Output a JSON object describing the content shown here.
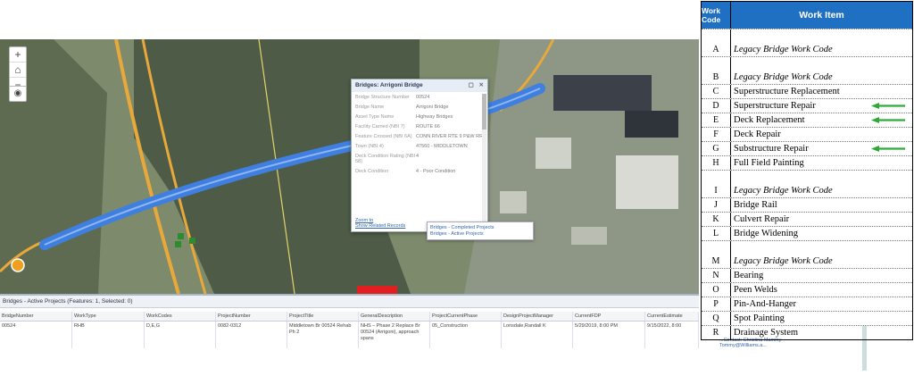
{
  "map": {
    "icons": {
      "zoom_in": "plus-icon",
      "home": "home-icon",
      "zoom_out": "minus-icon",
      "locate": "locate-icon"
    },
    "glyphs": {
      "zoom_in": "+",
      "home": "⌂",
      "zoom_out": "−",
      "locate": "◉"
    },
    "colors": {
      "bridge_highlight": "#3f7fe0",
      "river": "#4e5b47",
      "road": "#e8a93a",
      "active_project": "#e02020"
    }
  },
  "popup": {
    "title": "Bridges: Arrigoni Bridge",
    "controls": [
      "▢",
      "✕"
    ],
    "fields": [
      {
        "label": "Bridge Structure Number",
        "value": "00524"
      },
      {
        "label": "Bridge Name",
        "value": "Arrigoni Bridge"
      },
      {
        "label": "Asset Type Name",
        "value": "Highway Bridges"
      },
      {
        "label": "Facility Carried (NBI 7)",
        "value": "ROUTE 66"
      },
      {
        "label": "Feature Crossed (NBI 6A)",
        "value": "CONN RIVER RTE 9 P&W RR"
      },
      {
        "label": "Town (NBI 4)",
        "value": "47560 - MIDDLETOWN"
      },
      {
        "label": "Deck Condition Rating (NBI 58)",
        "value": "4"
      },
      {
        "label": "Deck Condition",
        "value": "4 - Poor Condition"
      }
    ],
    "links": {
      "zoom": "Zoom to",
      "related": "Show Related Records"
    }
  },
  "related_menu": {
    "items": [
      "Bridges - Completed Projects",
      "Bridges - Active Projects"
    ]
  },
  "table": {
    "title": "Bridges - Active Projects (Features: 1, Selected: 0)",
    "columns": [
      "BridgeNumber",
      "WorkType",
      "WorkCodes",
      "ProjectNumber",
      "ProjectTitle",
      "GeneralDescription",
      "ProjectCurrentPhase",
      "DesignProjectManager",
      "CurrentFDP",
      "CurrentEstimate"
    ],
    "rows": [
      [
        "00524",
        "RHB",
        "D,E,G",
        "0082-0312",
        "Middletown Br 00524 Rehab Ph 2",
        "NHS – Phase 2 Replace Br 00524 (Arrigoni), approach spans",
        "05_Construction",
        "Lonsdale,Randall K",
        "5/29/2019, 8:00 PM",
        "9/15/2022, 8:00"
      ]
    ],
    "overflow_text": "...Contact: Christina Mammy Tommy@Williams.a..."
  },
  "work_codes": {
    "header_code": "Work Code",
    "header_item": "Work Item",
    "rows": [
      {
        "code": "A",
        "item": "Legacy Bridge Work Code",
        "italic": true,
        "tall": true,
        "arrow": false
      },
      {
        "code": "B",
        "item": "Legacy Bridge Work Code",
        "italic": true,
        "tall": true,
        "arrow": false
      },
      {
        "code": "C",
        "item": "Superstructure Replacement",
        "italic": false,
        "tall": false,
        "arrow": false
      },
      {
        "code": "D",
        "item": "Superstructure Repair",
        "italic": false,
        "tall": false,
        "arrow": true
      },
      {
        "code": "E",
        "item": "Deck Replacement",
        "italic": false,
        "tall": false,
        "arrow": true
      },
      {
        "code": "F",
        "item": "Deck Repair",
        "italic": false,
        "tall": false,
        "arrow": false
      },
      {
        "code": "G",
        "item": "Substructure Repair",
        "italic": false,
        "tall": false,
        "arrow": true
      },
      {
        "code": "H",
        "item": "Full Field Painting",
        "italic": false,
        "tall": false,
        "arrow": false
      },
      {
        "code": "I",
        "item": "Legacy Bridge Work Code",
        "italic": true,
        "tall": true,
        "arrow": false
      },
      {
        "code": "J",
        "item": "Bridge Rail",
        "italic": false,
        "tall": false,
        "arrow": false
      },
      {
        "code": "K",
        "item": "Culvert Repair",
        "italic": false,
        "tall": false,
        "arrow": false
      },
      {
        "code": "L",
        "item": "Bridge Widening",
        "italic": false,
        "tall": false,
        "arrow": false
      },
      {
        "code": "M",
        "item": "Legacy Bridge Work Code",
        "italic": true,
        "tall": true,
        "arrow": false
      },
      {
        "code": "N",
        "item": "Bearing",
        "italic": false,
        "tall": false,
        "arrow": false
      },
      {
        "code": "O",
        "item": "Peen Welds",
        "italic": false,
        "tall": false,
        "arrow": false
      },
      {
        "code": "P",
        "item": "Pin-And-Hanger",
        "italic": false,
        "tall": false,
        "arrow": false
      },
      {
        "code": "Q",
        "item": "Spot Painting",
        "italic": false,
        "tall": false,
        "arrow": false
      },
      {
        "code": "R",
        "item": "Drainage System",
        "italic": false,
        "tall": false,
        "arrow": false
      }
    ],
    "arrow_color": "#2eaa3a",
    "header_color": "#1f6fc2"
  }
}
